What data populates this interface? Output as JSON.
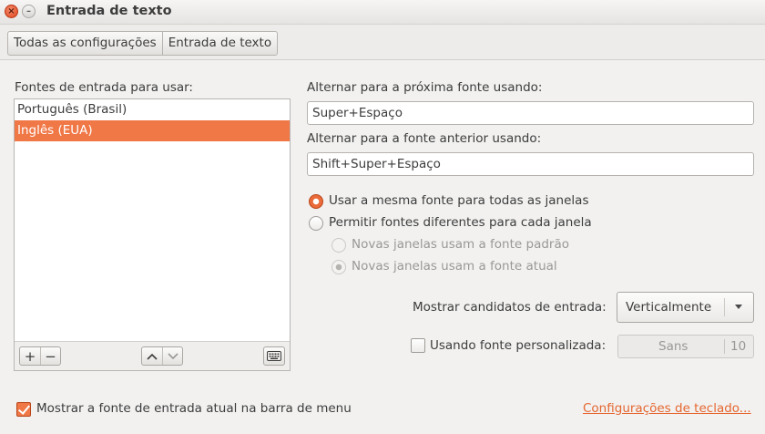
{
  "window": {
    "title": "Entrada de texto",
    "close_glyph": "×",
    "minimize_glyph": "–"
  },
  "breadcrumb": {
    "items": [
      "Todas as configurações",
      "Entrada de texto"
    ]
  },
  "sources": {
    "label": "Fontes de entrada para usar:",
    "items": [
      {
        "label": "Português (Brasil)",
        "selected": false
      },
      {
        "label": "Inglês (EUA)",
        "selected": true
      }
    ],
    "toolbar": {
      "add": "+",
      "remove": "−",
      "up": "⌃",
      "down": "⌄"
    }
  },
  "shortcuts": {
    "next_label": "Alternar para a próxima fonte usando:",
    "next_value": "Super+Espaço",
    "prev_label": "Alternar para a fonte anterior usando:",
    "prev_value": "Shift+Super+Espaço"
  },
  "per_window": {
    "same_label": "Usar a mesma fonte para todas as janelas",
    "same_selected": true,
    "different_label": "Permitir fontes diferentes para cada janela",
    "different_selected": false,
    "default_label": "Novas janelas usam a fonte padrão",
    "current_label": "Novas janelas usam a fonte atual",
    "current_selected": true
  },
  "candidates": {
    "label": "Mostrar candidatos de entrada:",
    "value": "Verticalmente"
  },
  "custom_font": {
    "label": "Usando fonte personalizada:",
    "checked": false,
    "font_name": "Sans",
    "font_size": "10"
  },
  "footer": {
    "show_indicator_label": "Mostrar a fonte de entrada atual na barra de menu",
    "show_indicator_checked": true,
    "keyboard_link": "Configurações de teclado..."
  },
  "colors": {
    "accent": "#f07746",
    "link": "#e5662f",
    "window_bg": "#f2f1f0"
  }
}
